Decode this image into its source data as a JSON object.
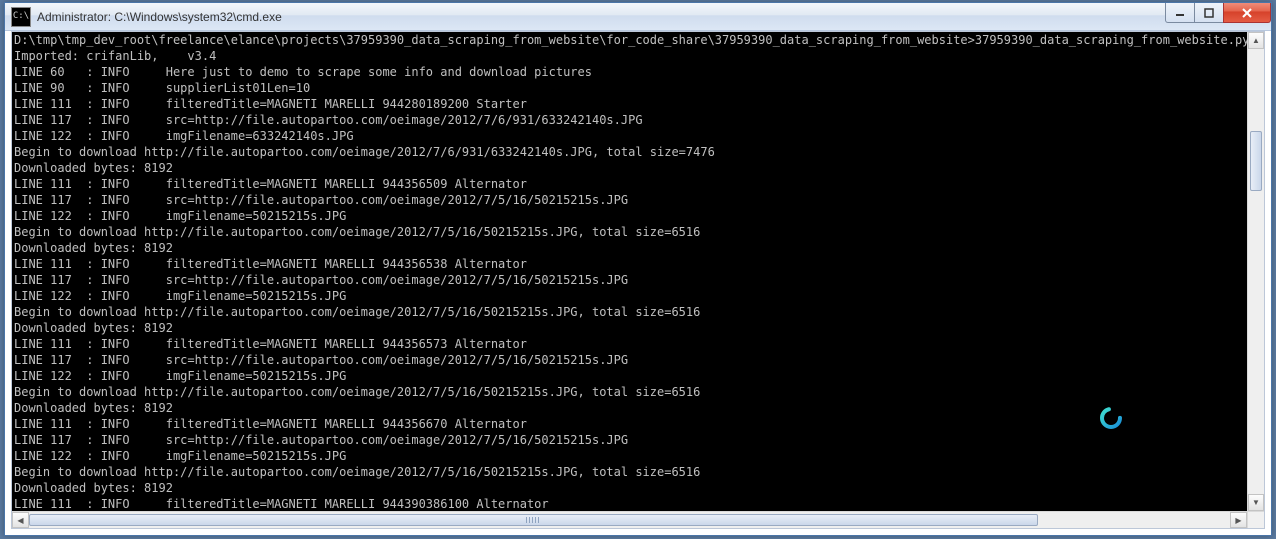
{
  "window": {
    "icon_label": "C:\\",
    "title": "Administrator: C:\\Windows\\system32\\cmd.exe"
  },
  "console_lines": [
    "D:\\tmp\\tmp_dev_root\\freelance\\elance\\projects\\37959390_data_scraping_from_website\\for_code_share\\37959390_data_scraping_from_website>37959390_data_scraping_from_website.py",
    "Imported: crifanLib,    v3.4",
    "LINE 60   : INFO     Here just to demo to scrape some info and download pictures",
    "LINE 90   : INFO     supplierList01Len=10",
    "LINE 111  : INFO     filteredTitle=MAGNETI MARELLI 944280189200 Starter",
    "LINE 117  : INFO     src=http://file.autopartoo.com/oeimage/2012/7/6/931/633242140s.JPG",
    "LINE 122  : INFO     imgFilename=633242140s.JPG",
    "Begin to download http://file.autopartoo.com/oeimage/2012/7/6/931/633242140s.JPG, total size=7476",
    "Downloaded bytes: 8192",
    "LINE 111  : INFO     filteredTitle=MAGNETI MARELLI 944356509 Alternator",
    "LINE 117  : INFO     src=http://file.autopartoo.com/oeimage/2012/7/5/16/50215215s.JPG",
    "LINE 122  : INFO     imgFilename=50215215s.JPG",
    "Begin to download http://file.autopartoo.com/oeimage/2012/7/5/16/50215215s.JPG, total size=6516",
    "Downloaded bytes: 8192",
    "LINE 111  : INFO     filteredTitle=MAGNETI MARELLI 944356538 Alternator",
    "LINE 117  : INFO     src=http://file.autopartoo.com/oeimage/2012/7/5/16/50215215s.JPG",
    "LINE 122  : INFO     imgFilename=50215215s.JPG",
    "Begin to download http://file.autopartoo.com/oeimage/2012/7/5/16/50215215s.JPG, total size=6516",
    "Downloaded bytes: 8192",
    "LINE 111  : INFO     filteredTitle=MAGNETI MARELLI 944356573 Alternator",
    "LINE 117  : INFO     src=http://file.autopartoo.com/oeimage/2012/7/5/16/50215215s.JPG",
    "LINE 122  : INFO     imgFilename=50215215s.JPG",
    "Begin to download http://file.autopartoo.com/oeimage/2012/7/5/16/50215215s.JPG, total size=6516",
    "Downloaded bytes: 8192",
    "LINE 111  : INFO     filteredTitle=MAGNETI MARELLI 944356670 Alternator",
    "LINE 117  : INFO     src=http://file.autopartoo.com/oeimage/2012/7/5/16/50215215s.JPG",
    "LINE 122  : INFO     imgFilename=50215215s.JPG",
    "Begin to download http://file.autopartoo.com/oeimage/2012/7/5/16/50215215s.JPG, total size=6516",
    "Downloaded bytes: 8192",
    "LINE 111  : INFO     filteredTitle=MAGNETI MARELLI 944390386100 Alternator"
  ]
}
